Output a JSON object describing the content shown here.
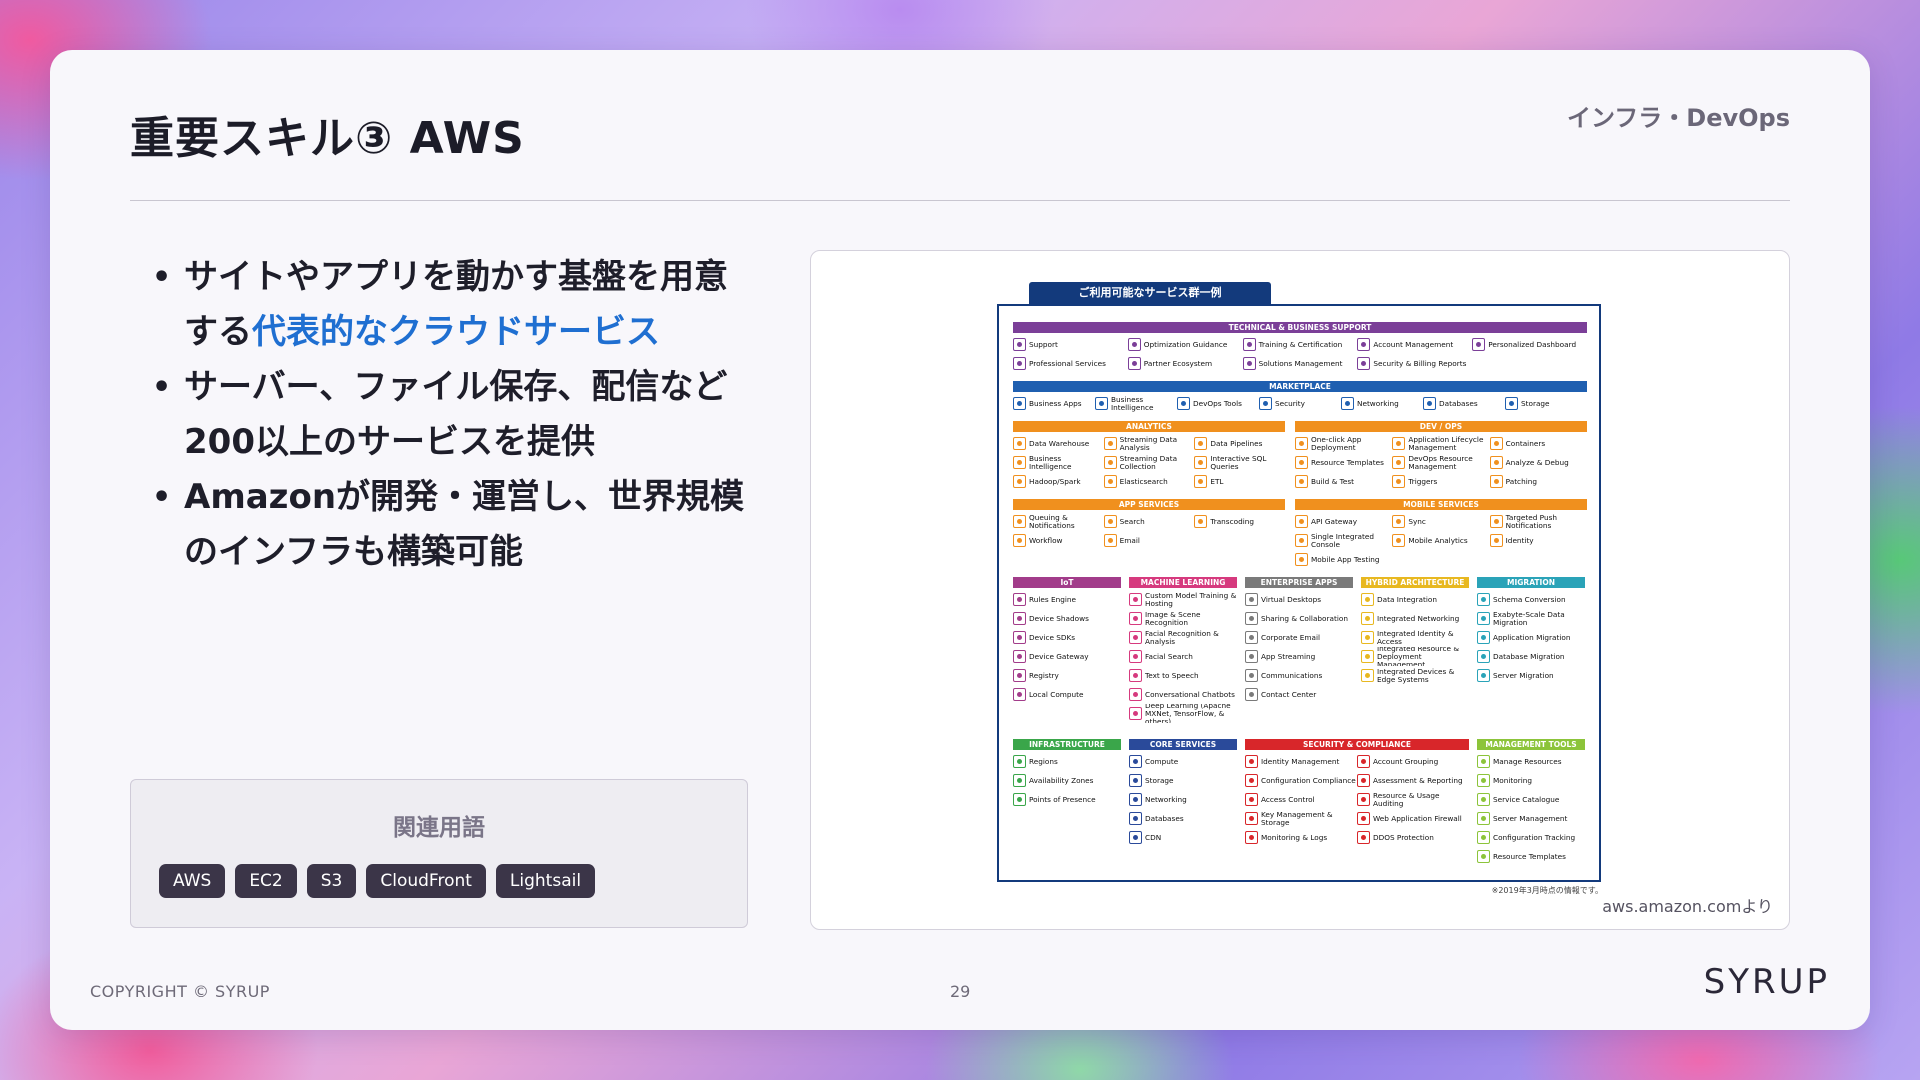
{
  "header": {
    "title": "重要スキル③ AWS",
    "category": "インフラ・DevOps"
  },
  "bullets": [
    {
      "text": "サイトやアプリを動かす基盤を用意する",
      "highlight": "代表的なクラウドサービス",
      "tail": ""
    },
    {
      "text": "サーバー、ファイル保存、配信など200以上のサービスを提供",
      "highlight": "",
      "tail": ""
    },
    {
      "text": "Amazonが開発・運営し、世界規模のインフラも構築可能",
      "highlight": "",
      "tail": ""
    }
  ],
  "related": {
    "title": "関連用語",
    "tags": [
      "AWS",
      "EC2",
      "S3",
      "CloudFront",
      "Lightsail"
    ]
  },
  "figure": {
    "caption": "aws.amazon.comより",
    "tab": "ご利用可能なサービス群一例",
    "note": "※2019年3月時点の情報です。",
    "groups": [
      {
        "name": "TECHNICAL & BUSINESS SUPPORT",
        "color": "#7b3f98",
        "items": [
          "Support",
          "Optimization Guidance",
          "Training & Certification",
          "Account Management",
          "Personalized Dashboard",
          "Professional Services",
          "Partner Ecosystem",
          "Solutions Management",
          "Security & Billing Reports"
        ]
      },
      {
        "name": "MARKETPLACE",
        "color": "#1f5fb0",
        "items": [
          "Business Apps",
          "Business Intelligence",
          "DevOps Tools",
          "Security",
          "Networking",
          "Databases",
          "Storage"
        ]
      },
      {
        "name": "ANALYTICS",
        "color": "#f0901e",
        "items": [
          "Data Warehouse",
          "Streaming Data Analysis",
          "Data Pipelines",
          "Business Intelligence",
          "Streaming Data Collection",
          "Interactive SQL Queries",
          "Hadoop/Spark",
          "Elasticsearch",
          "ETL"
        ]
      },
      {
        "name": "DEV / OPS",
        "color": "#f0901e",
        "items": [
          "One-click App Deployment",
          "Application Lifecycle Management",
          "Containers",
          "Resource Templates",
          "DevOps Resource Management",
          "Analyze & Debug",
          "Build & Test",
          "Triggers",
          "Patching"
        ]
      },
      {
        "name": "APP SERVICES",
        "color": "#f0901e",
        "items": [
          "Queuing & Notifications",
          "Search",
          "Transcoding",
          "Workflow",
          "Email"
        ]
      },
      {
        "name": "MOBILE SERVICES",
        "color": "#f0901e",
        "items": [
          "API Gateway",
          "Sync",
          "Targeted Push Notifications",
          "Single Integrated Console",
          "Mobile Analytics",
          "Identity",
          "Mobile App Testing"
        ]
      },
      {
        "name": "IoT",
        "color": "#a23c8a",
        "items": [
          "Rules Engine",
          "Device Shadows",
          "Device SDKs",
          "Device Gateway",
          "Registry",
          "Local Compute"
        ]
      },
      {
        "name": "MACHINE LEARNING",
        "color": "#d63a7e",
        "items": [
          "Custom Model Training & Hosting",
          "Image & Scene Recognition",
          "Facial Recognition & Analysis",
          "Facial Search",
          "Text to Speech",
          "Conversational Chatbots",
          "Deep Learning (Apache MXNet, TensorFlow, & others)"
        ]
      },
      {
        "name": "ENTERPRISE APPS",
        "color": "#7a7a7a",
        "items": [
          "Virtual Desktops",
          "Sharing & Collaboration",
          "Corporate Email",
          "App Streaming",
          "Communications",
          "Contact Center"
        ]
      },
      {
        "name": "HYBRID ARCHITECTURE",
        "color": "#e8b820",
        "items": [
          "Data Integration",
          "Integrated Networking",
          "Integrated Identity & Access",
          "Integrated Resource & Deployment Management",
          "Integrated Devices & Edge Systems"
        ]
      },
      {
        "name": "MIGRATION",
        "color": "#2aa3b8",
        "items": [
          "Schema Conversion",
          "Exabyte-Scale Data Migration",
          "Application Migration",
          "Database Migration",
          "Server Migration"
        ]
      },
      {
        "name": "INFRASTRUCTURE",
        "color": "#3aa64a",
        "items": [
          "Regions",
          "Availability Zones",
          "Points of Presence"
        ]
      },
      {
        "name": "CORE SERVICES",
        "color": "#2a4a9a",
        "items": [
          "Compute",
          "Storage",
          "Networking",
          "Databases",
          "CDN"
        ]
      },
      {
        "name": "SECURITY & COMPLIANCE",
        "color": "#d8262a",
        "items": [
          "Identity Management",
          "Account Grouping",
          "Configuration Compliance",
          "Assessment & Reporting",
          "Access Control",
          "Resource & Usage Auditing",
          "Key Management & Storage",
          "Web Application Firewall",
          "Monitoring & Logs",
          "DDOS Protection"
        ]
      },
      {
        "name": "MANAGEMENT TOOLS",
        "color": "#8cc43a",
        "items": [
          "Manage Resources",
          "Monitoring",
          "Service Catalogue",
          "Server Management",
          "Configuration Tracking",
          "Resource Templates"
        ]
      }
    ]
  },
  "footer": {
    "copyright": "COPYRIGHT © SYRUP",
    "page": "29",
    "logo": "SYRUP"
  }
}
